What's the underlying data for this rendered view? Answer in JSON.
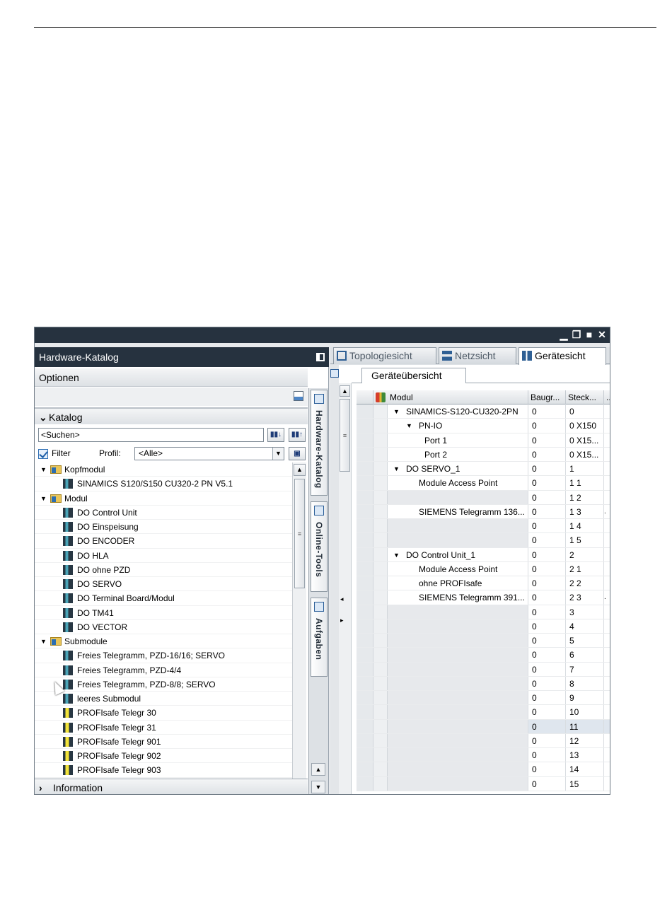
{
  "window": {
    "controls": [
      "▁",
      "❐",
      "■",
      "✕"
    ]
  },
  "hardware_catalog": {
    "title": "Hardware-Katalog",
    "options_label": "Optionen",
    "catalog_label": "Katalog",
    "search_placeholder": "<Suchen>",
    "filter_label": "Filter",
    "profile_label": "Profil:",
    "profile_value": "<Alle>",
    "tree": [
      {
        "level": 0,
        "type": "folder",
        "expanded": true,
        "label": "Kopfmodul"
      },
      {
        "level": 1,
        "type": "module",
        "label": "SINAMICS S120/S150 CU320-2 PN V5.1"
      },
      {
        "level": 0,
        "type": "folder",
        "expanded": true,
        "label": "Modul"
      },
      {
        "level": 1,
        "type": "module",
        "label": "DO Control Unit"
      },
      {
        "level": 1,
        "type": "module",
        "label": "DO Einspeisung"
      },
      {
        "level": 1,
        "type": "module",
        "label": "DO ENCODER"
      },
      {
        "level": 1,
        "type": "module",
        "label": "DO HLA"
      },
      {
        "level": 1,
        "type": "module",
        "label": "DO ohne PZD"
      },
      {
        "level": 1,
        "type": "module",
        "label": "DO SERVO"
      },
      {
        "level": 1,
        "type": "module",
        "label": "DO Terminal Board/Modul"
      },
      {
        "level": 1,
        "type": "module",
        "label": "DO TM41"
      },
      {
        "level": 1,
        "type": "module",
        "label": "DO VECTOR"
      },
      {
        "level": 0,
        "type": "folder",
        "expanded": true,
        "label": "Submodule"
      },
      {
        "level": 1,
        "type": "module",
        "label": "Freies Telegramm, PZD-16/16; SERVO"
      },
      {
        "level": 1,
        "type": "module",
        "label": "Freies Telegramm, PZD-4/4"
      },
      {
        "level": 1,
        "type": "module",
        "label": "Freies Telegramm, PZD-8/8; SERVO"
      },
      {
        "level": 1,
        "type": "module",
        "label": "leeres Submodul"
      },
      {
        "level": 1,
        "type": "safe",
        "label": "PROFIsafe Telegr 30"
      },
      {
        "level": 1,
        "type": "safe",
        "label": "PROFIsafe Telegr 31"
      },
      {
        "level": 1,
        "type": "safe",
        "label": "PROFIsafe Telegr 901"
      },
      {
        "level": 1,
        "type": "safe",
        "label": "PROFIsafe Telegr 902"
      },
      {
        "level": 1,
        "type": "safe",
        "label": "PROFIsafe Telegr 903"
      }
    ],
    "information_label": "Information"
  },
  "side_tabs": [
    "Hardware-Katalog",
    "Online-Tools",
    "Aufgaben"
  ],
  "view_tabs": {
    "topology": "Topologiesicht",
    "network": "Netzsicht",
    "device": "Gerätesicht"
  },
  "device_overview": {
    "tab_label": "Geräteübersicht",
    "columns": {
      "module": "Modul",
      "rack": "Baugr...",
      "slot": "Steck...",
      "extra": ".."
    },
    "rows": [
      {
        "indent": 0,
        "tri": "▼",
        "module": "SINAMICS-S120-CU320-2PN",
        "rack": "0",
        "slot": "0",
        "extra": ""
      },
      {
        "indent": 1,
        "tri": "▼",
        "module": "PN-IO",
        "rack": "0",
        "slot": "0 X150",
        "extra": ""
      },
      {
        "indent": 2,
        "tri": "",
        "module": "Port 1",
        "rack": "0",
        "slot": "0 X15...",
        "extra": ""
      },
      {
        "indent": 2,
        "tri": "",
        "module": "Port 2",
        "rack": "0",
        "slot": "0 X15...",
        "extra": ""
      },
      {
        "indent": 0,
        "tri": "▼",
        "module": "DO SERVO_1",
        "rack": "0",
        "slot": "1",
        "extra": ""
      },
      {
        "indent": 1,
        "tri": "",
        "module": "Module Access Point",
        "rack": "0",
        "slot": "1 1",
        "extra": ""
      },
      {
        "indent": -1,
        "tri": "",
        "module": "",
        "rack": "0",
        "slot": "1 2",
        "extra": ""
      },
      {
        "indent": 1,
        "tri": "",
        "module": "SIEMENS Telegramm 136...",
        "rack": "0",
        "slot": "1 3",
        "extra": "."
      },
      {
        "indent": -1,
        "tri": "",
        "module": "",
        "rack": "0",
        "slot": "1 4",
        "extra": ""
      },
      {
        "indent": -1,
        "tri": "",
        "module": "",
        "rack": "0",
        "slot": "1 5",
        "extra": ""
      },
      {
        "indent": 0,
        "tri": "▼",
        "module": "DO Control Unit_1",
        "rack": "0",
        "slot": "2",
        "extra": ""
      },
      {
        "indent": 1,
        "tri": "",
        "module": "Module Access Point",
        "rack": "0",
        "slot": "2 1",
        "extra": ""
      },
      {
        "indent": 1,
        "tri": "",
        "module": "ohne PROFIsafe",
        "rack": "0",
        "slot": "2 2",
        "extra": ""
      },
      {
        "indent": 1,
        "tri": "",
        "module": "SIEMENS Telegramm 391...",
        "rack": "0",
        "slot": "2 3",
        "extra": "."
      },
      {
        "indent": -1,
        "tri": "",
        "module": "",
        "rack": "0",
        "slot": "3",
        "extra": ""
      },
      {
        "indent": -1,
        "tri": "",
        "module": "",
        "rack": "0",
        "slot": "4",
        "extra": ""
      },
      {
        "indent": -1,
        "tri": "",
        "module": "",
        "rack": "0",
        "slot": "5",
        "extra": ""
      },
      {
        "indent": -1,
        "tri": "",
        "module": "",
        "rack": "0",
        "slot": "6",
        "extra": ""
      },
      {
        "indent": -1,
        "tri": "",
        "module": "",
        "rack": "0",
        "slot": "7",
        "extra": ""
      },
      {
        "indent": -1,
        "tri": "",
        "module": "",
        "rack": "0",
        "slot": "8",
        "extra": ""
      },
      {
        "indent": -1,
        "tri": "",
        "module": "",
        "rack": "0",
        "slot": "9",
        "extra": ""
      },
      {
        "indent": -1,
        "tri": "",
        "module": "",
        "rack": "0",
        "slot": "10",
        "extra": ""
      },
      {
        "indent": -1,
        "tri": "",
        "module": "",
        "rack": "0",
        "slot": "11",
        "extra": "",
        "selected": true
      },
      {
        "indent": -1,
        "tri": "",
        "module": "",
        "rack": "0",
        "slot": "12",
        "extra": ""
      },
      {
        "indent": -1,
        "tri": "",
        "module": "",
        "rack": "0",
        "slot": "13",
        "extra": ""
      },
      {
        "indent": -1,
        "tri": "",
        "module": "",
        "rack": "0",
        "slot": "14",
        "extra": ""
      },
      {
        "indent": -1,
        "tri": "",
        "module": "",
        "rack": "0",
        "slot": "15",
        "extra": ""
      }
    ]
  }
}
